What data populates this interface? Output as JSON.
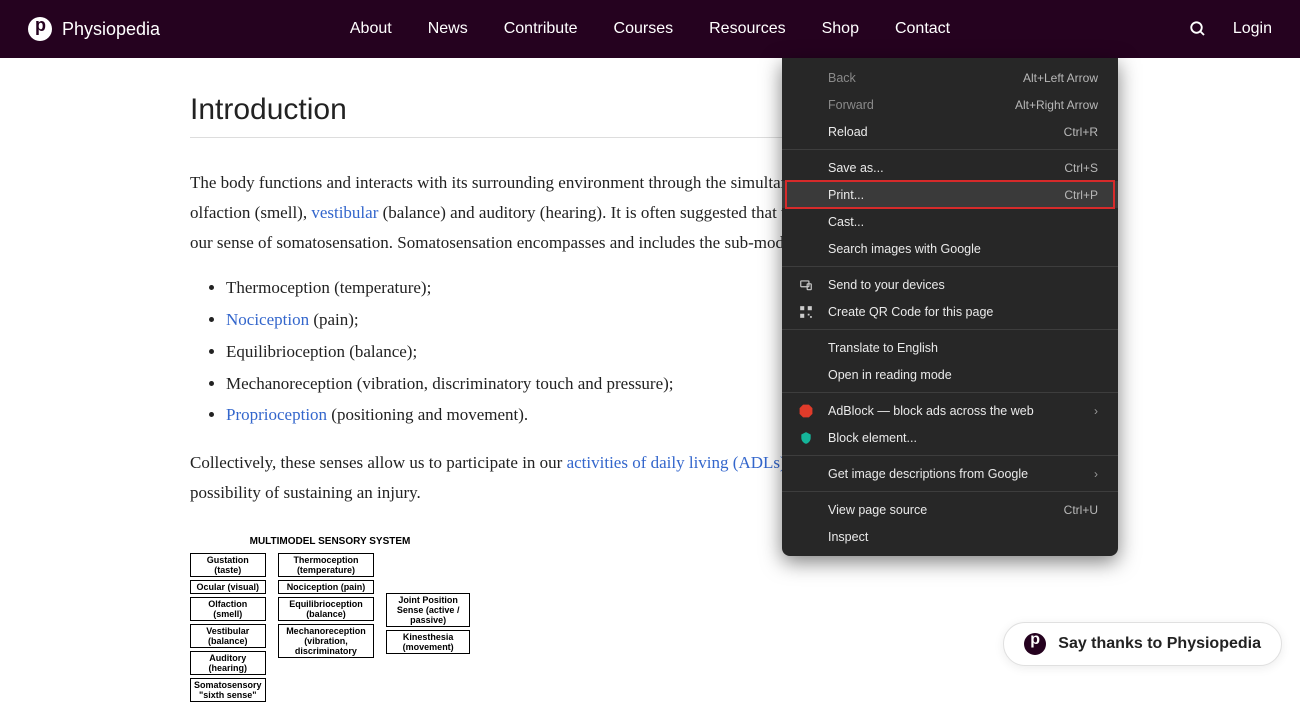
{
  "header": {
    "brand": "Physiopedia",
    "nav": [
      "About",
      "News",
      "Contribute",
      "Courses",
      "Resources",
      "Shop",
      "Contact"
    ],
    "login": "Login"
  },
  "article": {
    "heading": "Introduction",
    "para1_a": "The body functions and interacts with its surrounding environment through the simultaneous use of gustation (taste), ocular (vision), olfaction (smell), ",
    "link_vestibular": "vestibular",
    "para1_b": " (balance) and auditory (hearing). It is often suggested that we also have a \"sixth sense\", understood to be our sense of somatosensation. Somatosensation encompasses and includes the sub-modalities of:",
    "list": {
      "item1": "Thermoception (temperature);",
      "item2_link": "Nociception",
      "item2_rest": " (pain);",
      "item3": "Equilibrioception (balance);",
      "item4": "Mechanoreception (vibration, discriminatory touch and pressure);",
      "item5_link": "Proprioception",
      "item5_rest": " (positioning and movement)."
    },
    "para2_a": "Collectively, these senses allow us to participate in our ",
    "link_adl": "activities of daily living (ADLs)",
    "para2_b": " safely and effectively, whilst minimizing the possibility of sustaining an injury."
  },
  "diagram": {
    "title": "MULTIMODEL SENSORY SYSTEM",
    "left": [
      "Gustation (taste)",
      "Ocular (visual)",
      "Olfaction (smell)",
      "Vestibular (balance)",
      "Auditory (hearing)",
      "Somatosensory \"sixth sense\""
    ],
    "middle": [
      "Thermoception (temperature)",
      "Nociception (pain)",
      "Equilibrioception (balance)",
      "Mechanoreception (vibration, discriminatory"
    ],
    "right": [
      "Joint Position Sense (active / passive)",
      "Kinesthesia (movement)"
    ]
  },
  "context_menu": {
    "back": "Back",
    "back_sc": "Alt+Left Arrow",
    "forward": "Forward",
    "forward_sc": "Alt+Right Arrow",
    "reload": "Reload",
    "reload_sc": "Ctrl+R",
    "save_as": "Save as...",
    "save_as_sc": "Ctrl+S",
    "print": "Print...",
    "print_sc": "Ctrl+P",
    "cast": "Cast...",
    "search_images": "Search images with Google",
    "send_devices": "Send to your devices",
    "create_qr": "Create QR Code for this page",
    "translate": "Translate to English",
    "reading_mode": "Open in reading mode",
    "adblock": "AdBlock — block ads across the web",
    "block_element": "Block element...",
    "img_desc": "Get image descriptions from Google",
    "view_source": "View page source",
    "view_source_sc": "Ctrl+U",
    "inspect": "Inspect"
  },
  "thanks": {
    "label": "Say thanks to Physiopedia"
  }
}
